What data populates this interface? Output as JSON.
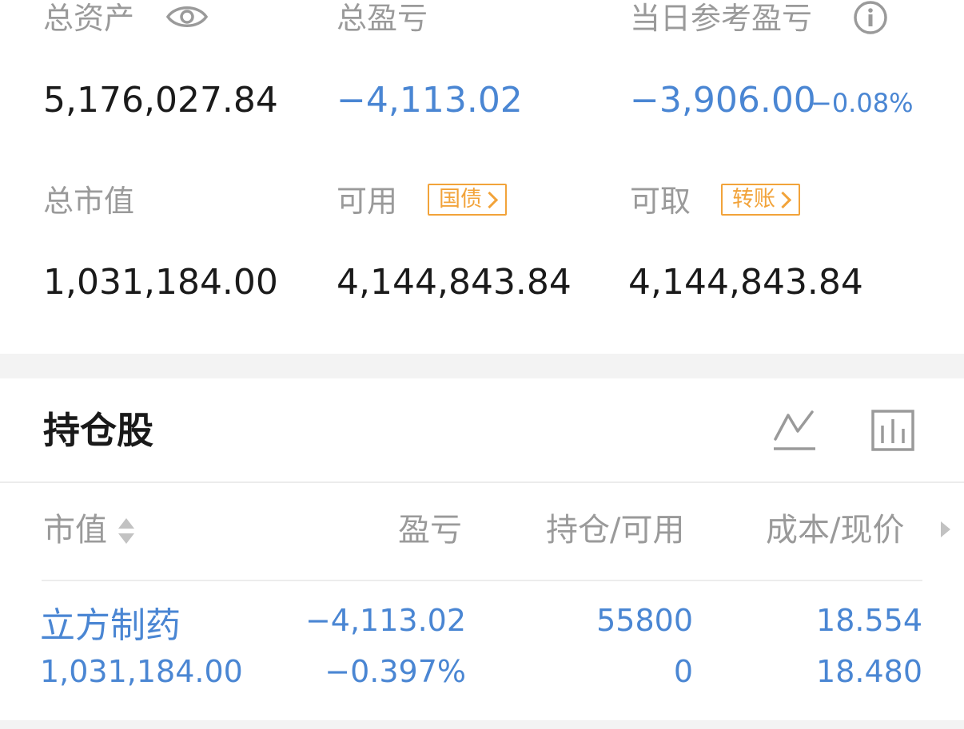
{
  "summary": {
    "total_assets_label": "总资产",
    "total_pnl_label": "总盈亏",
    "daily_pnl_label": "当日参考盈亏",
    "total_assets_value": "5,176,027.84",
    "total_pnl_value": "−4,113.02",
    "daily_pnl_value": "−3,906.00",
    "daily_pnl_pct": "−0.08%",
    "market_value_label": "总市值",
    "available_label": "可用",
    "withdrawable_label": "可取",
    "available_tag": "国债",
    "withdrawable_tag": "转账",
    "market_value_value": "1,031,184.00",
    "available_value": "4,144,843.84",
    "withdrawable_value": "4,144,843.84"
  },
  "holdings": {
    "title": "持仓股",
    "columns": {
      "market_value": "市值",
      "pnl": "盈亏",
      "position": "持仓/可用",
      "cost_price": "成本/现价"
    },
    "rows": [
      {
        "name": "立方制药",
        "market_value": "1,031,184.00",
        "pnl": "−4,113.02",
        "pnl_pct": "−0.397%",
        "position": "55800",
        "available": "0",
        "cost": "18.554",
        "price": "18.480"
      }
    ]
  },
  "icons": {
    "visibility": "eye-icon",
    "info": "info-icon",
    "line_chart": "line-chart-icon",
    "bar_chart": "bar-chart-icon",
    "sort": "sort-icon",
    "more_columns": "caret-right-icon"
  },
  "colors": {
    "accent_blue": "#4a86d3",
    "tag_orange": "#f2a33a",
    "label_gray": "#9a9a9a",
    "text_dark": "#1a1a1a"
  }
}
